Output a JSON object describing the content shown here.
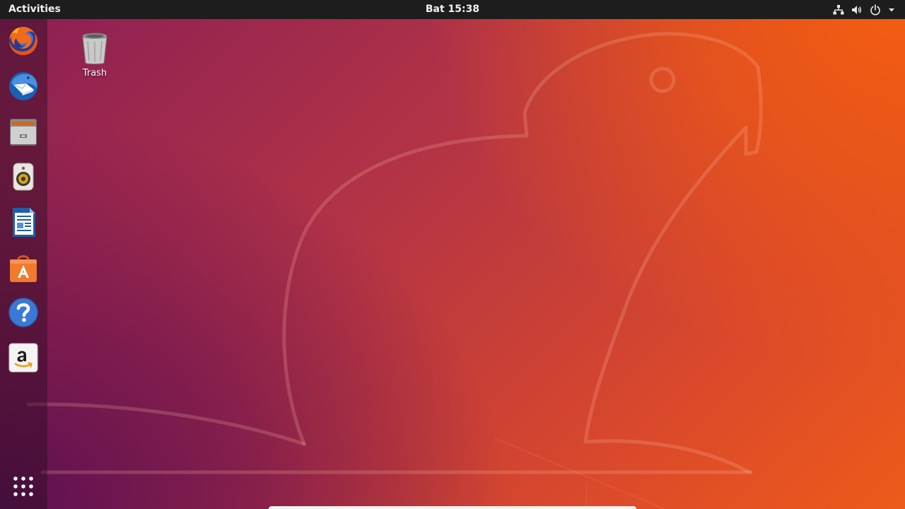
{
  "top_bar": {
    "activities_label": "Activities",
    "clock": "Bat 15:38",
    "tray_icons": [
      "network-icon",
      "volume-icon",
      "power-icon",
      "menu-arrow-icon"
    ]
  },
  "dock": {
    "items": [
      {
        "name": "Firefox Web Browser",
        "icon": "firefox-icon"
      },
      {
        "name": "Thunderbird Mail",
        "icon": "thunderbird-icon"
      },
      {
        "name": "Files",
        "icon": "files-icon"
      },
      {
        "name": "Rhythmbox",
        "icon": "rhythmbox-icon"
      },
      {
        "name": "LibreOffice Writer",
        "icon": "libreoffice-writer-icon"
      },
      {
        "name": "Ubuntu Software",
        "icon": "ubuntu-software-icon"
      },
      {
        "name": "Help",
        "icon": "help-icon"
      },
      {
        "name": "Amazon",
        "icon": "amazon-icon"
      }
    ],
    "show_applications_icon": "app-grid-icon"
  },
  "desktop": {
    "icons": [
      {
        "label": "Trash",
        "icon": "trash-icon"
      }
    ]
  },
  "colors": {
    "top_bar": "#1d1d1d",
    "wallpaper_orange": "#ee5a19",
    "wallpaper_purple": "#5c1051"
  }
}
